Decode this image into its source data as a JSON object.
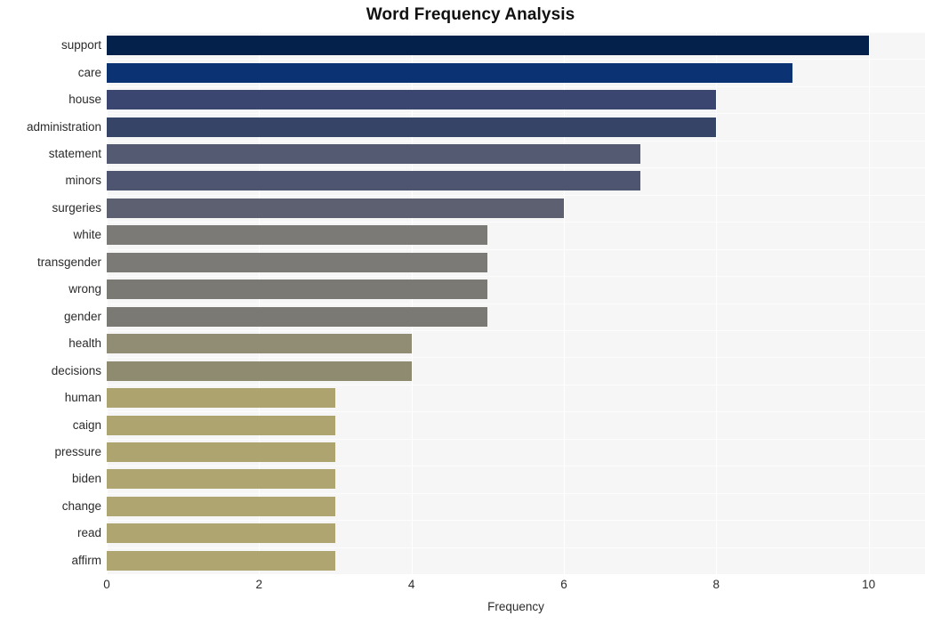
{
  "chart_data": {
    "type": "bar",
    "orientation": "horizontal",
    "title": "Word Frequency Analysis",
    "xlabel": "Frequency",
    "ylabel": "",
    "xlim": [
      0,
      10.74
    ],
    "xticks": [
      0,
      2,
      4,
      6,
      8,
      10
    ],
    "xtick_labels": [
      "0",
      "2",
      "4",
      "6",
      "8",
      "10"
    ],
    "grid": true,
    "grid_color": "#ffffff",
    "plot_background": "#f6f6f7",
    "figure_background": "#ffffff",
    "legend": null,
    "categories": [
      "support",
      "care",
      "house",
      "administration",
      "statement",
      "minors",
      "surgeries",
      "white",
      "transgender",
      "wrong",
      "gender",
      "health",
      "decisions",
      "human",
      "caign",
      "pressure",
      "biden",
      "change",
      "read",
      "affirm"
    ],
    "values": [
      10,
      9,
      8,
      8,
      7,
      7,
      6,
      5,
      5,
      5,
      5,
      4,
      4,
      3,
      3,
      3,
      3,
      3,
      3,
      3
    ],
    "bar_colors": [
      "#04214c",
      "#0b3272",
      "#3a4670",
      "#364468",
      "#535a72",
      "#4e5570",
      "#5d6070",
      "#7b7a77",
      "#7b7a77",
      "#7a7974",
      "#7a7974",
      "#918d74",
      "#8f8b70",
      "#ad a36e",
      "#aea470",
      "#aea470",
      "#afa571",
      "#afa571",
      "#afa571",
      "#afa571"
    ]
  }
}
